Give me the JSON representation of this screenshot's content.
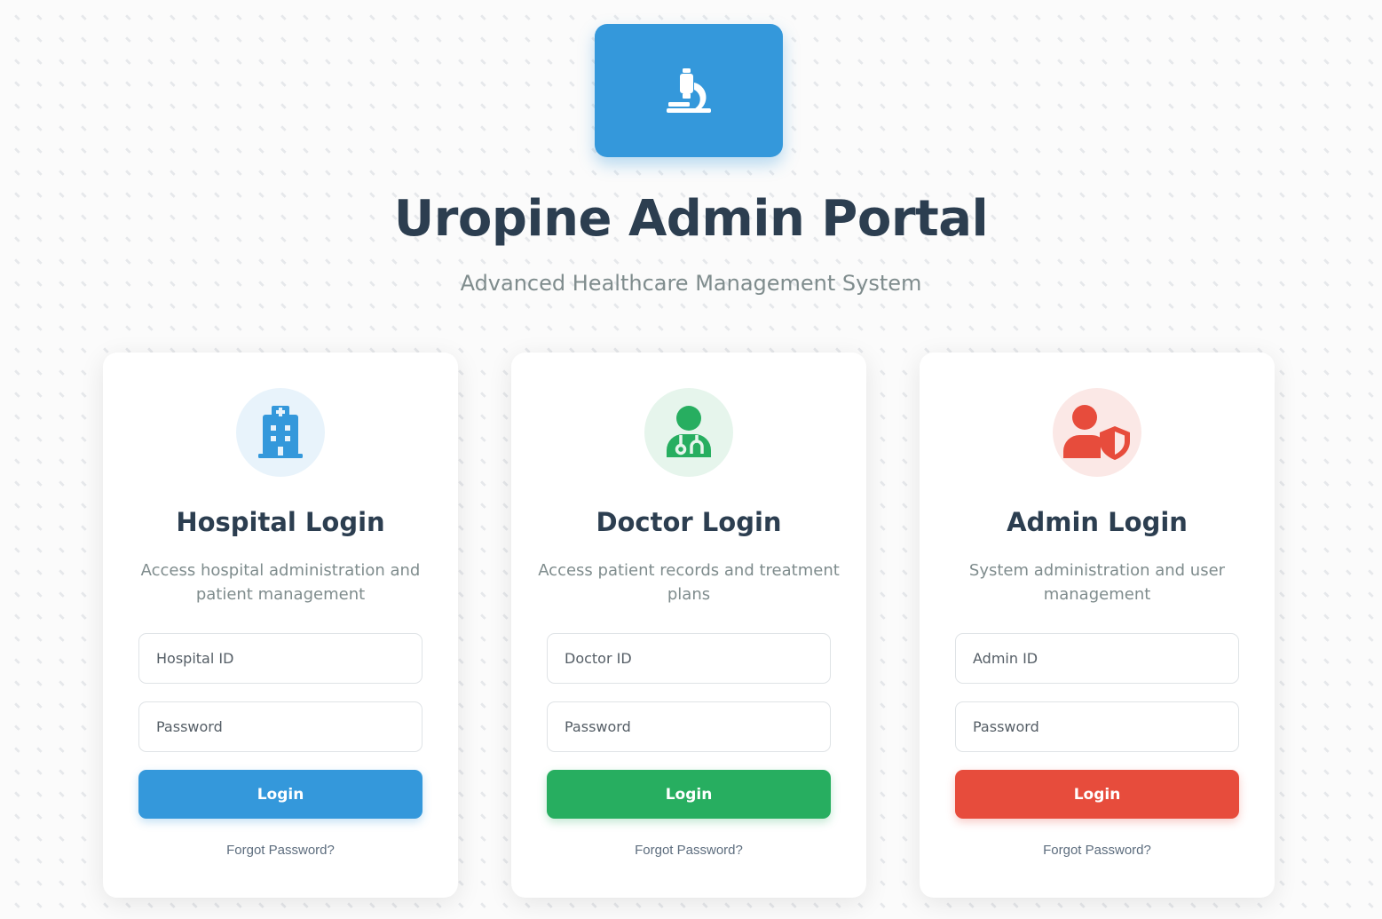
{
  "header": {
    "title": "Uropine Admin Portal",
    "subtitle": "Advanced Healthcare Management System",
    "logo_icon": "microscope-icon"
  },
  "colors": {
    "primary": "#3498db",
    "doctor": "#27ae60",
    "admin": "#e74c3c",
    "heading": "#2c3e50",
    "muted": "#7f8c8d"
  },
  "cards": [
    {
      "title": "Hospital Login",
      "description": "Access hospital administration and patient management",
      "icon": "hospital-icon",
      "id_placeholder": "Hospital ID",
      "password_placeholder": "Password",
      "button_label": "Login",
      "forgot_label": "Forgot Password?"
    },
    {
      "title": "Doctor Login",
      "description": "Access patient records and treatment plans",
      "icon": "doctor-icon",
      "id_placeholder": "Doctor ID",
      "password_placeholder": "Password",
      "button_label": "Login",
      "forgot_label": "Forgot Password?"
    },
    {
      "title": "Admin Login",
      "description": "System administration and user management",
      "icon": "user-shield-icon",
      "id_placeholder": "Admin ID",
      "password_placeholder": "Password",
      "button_label": "Login",
      "forgot_label": "Forgot Password?"
    }
  ]
}
